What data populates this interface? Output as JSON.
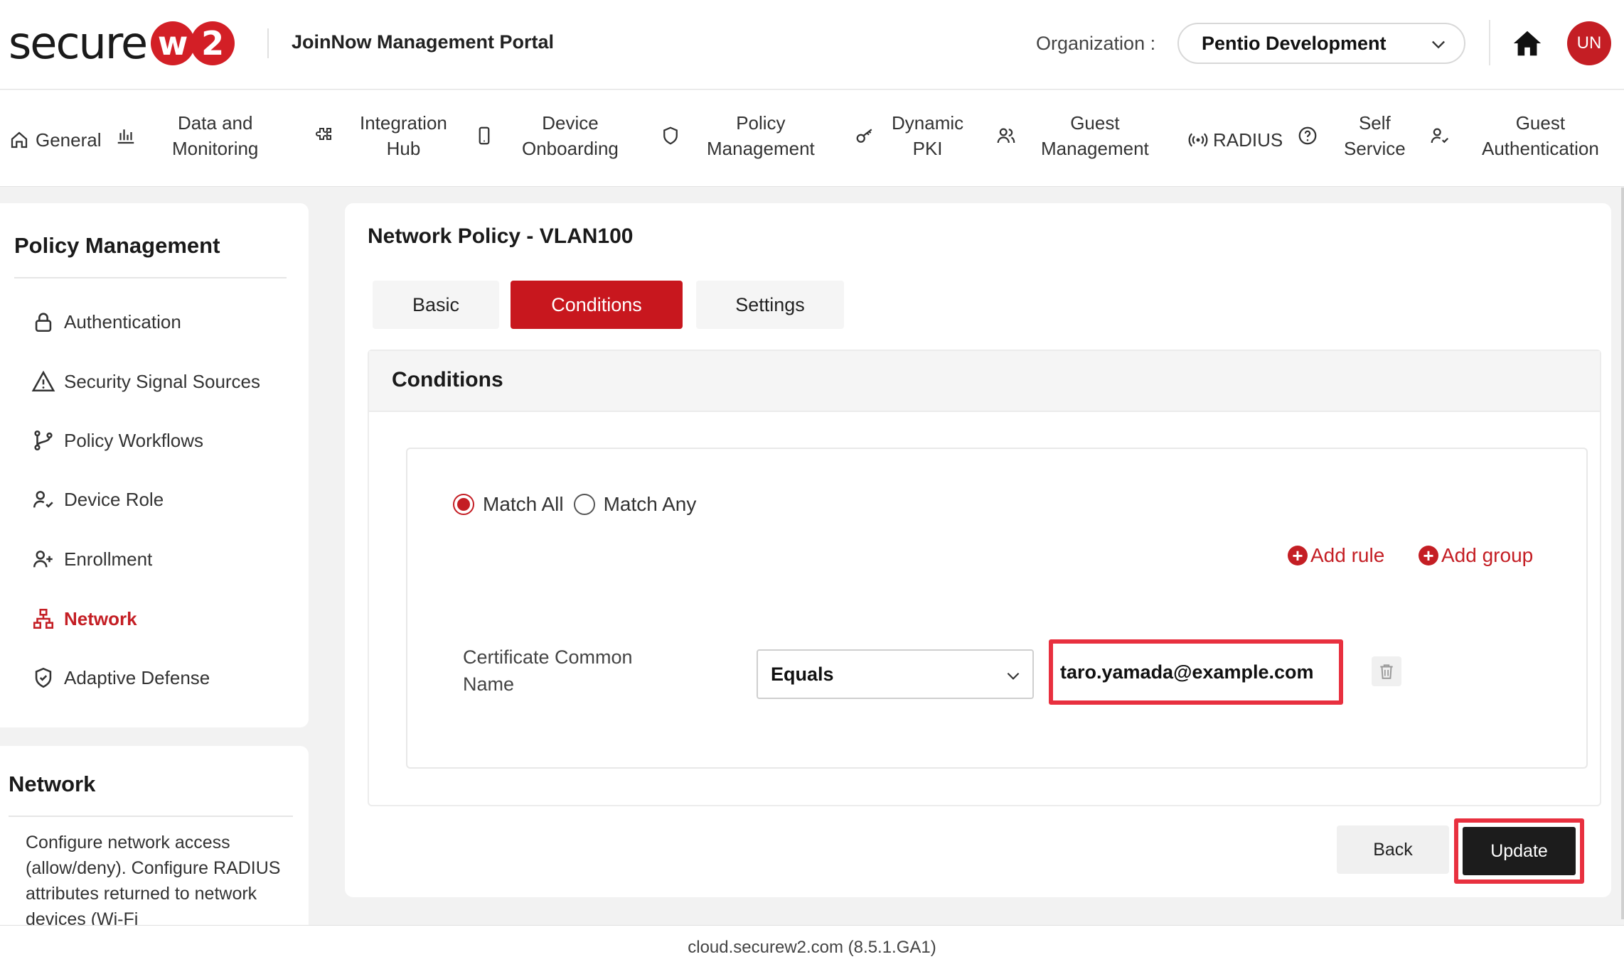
{
  "header": {
    "logo_text": "secure",
    "logo_w": "w",
    "logo_2": "2",
    "portal_title": "JoinNow Management Portal",
    "org_label": "Organization :",
    "org_value": "Pentio Development",
    "avatar_initials": "UN"
  },
  "nav": {
    "items": [
      {
        "line1": "General",
        "line2": ""
      },
      {
        "line1": "Data and",
        "line2": "Monitoring"
      },
      {
        "line1": "Integration",
        "line2": "Hub"
      },
      {
        "line1": "Device",
        "line2": "Onboarding"
      },
      {
        "line1": "Policy",
        "line2": "Management"
      },
      {
        "line1": "Dynamic",
        "line2": "PKI"
      },
      {
        "line1": "Guest",
        "line2": "Management"
      },
      {
        "line1": "RADIUS",
        "line2": ""
      },
      {
        "line1": "Self",
        "line2": "Service"
      },
      {
        "line1": "Guest",
        "line2": "Authentication"
      }
    ]
  },
  "sidebar": {
    "title": "Policy Management",
    "items": [
      {
        "label": "Authentication"
      },
      {
        "label": "Security Signal Sources"
      },
      {
        "label": "Policy Workflows"
      },
      {
        "label": "Device Role"
      },
      {
        "label": "Enrollment"
      },
      {
        "label": "Network"
      },
      {
        "label": "Adaptive Defense"
      }
    ],
    "active_color": "#c41e24"
  },
  "info": {
    "title": "Network",
    "text": "Configure network access (allow/deny). Configure RADIUS attributes returned to network devices (Wi-Fi"
  },
  "main": {
    "title": "Network Policy - VLAN100",
    "tabs": [
      {
        "label": "Basic"
      },
      {
        "label": "Conditions"
      },
      {
        "label": "Settings"
      }
    ],
    "active_tab": "Conditions",
    "conditions": {
      "heading": "Conditions",
      "match_all": "Match All",
      "match_any": "Match Any",
      "selected_match": "Match All",
      "add_rule": "Add rule",
      "add_group": "Add group",
      "rule": {
        "field_label": "Certificate Common Name",
        "operator": "Equals",
        "value": "taro.yamada@example.com"
      }
    },
    "back_label": "Back",
    "update_label": "Update"
  },
  "footer": {
    "text": "cloud.securew2.com (8.5.1.GA1)"
  },
  "colors": {
    "brand": "#d31f26",
    "highlight": "#e8303f",
    "update_bg": "#1c1c1c"
  }
}
